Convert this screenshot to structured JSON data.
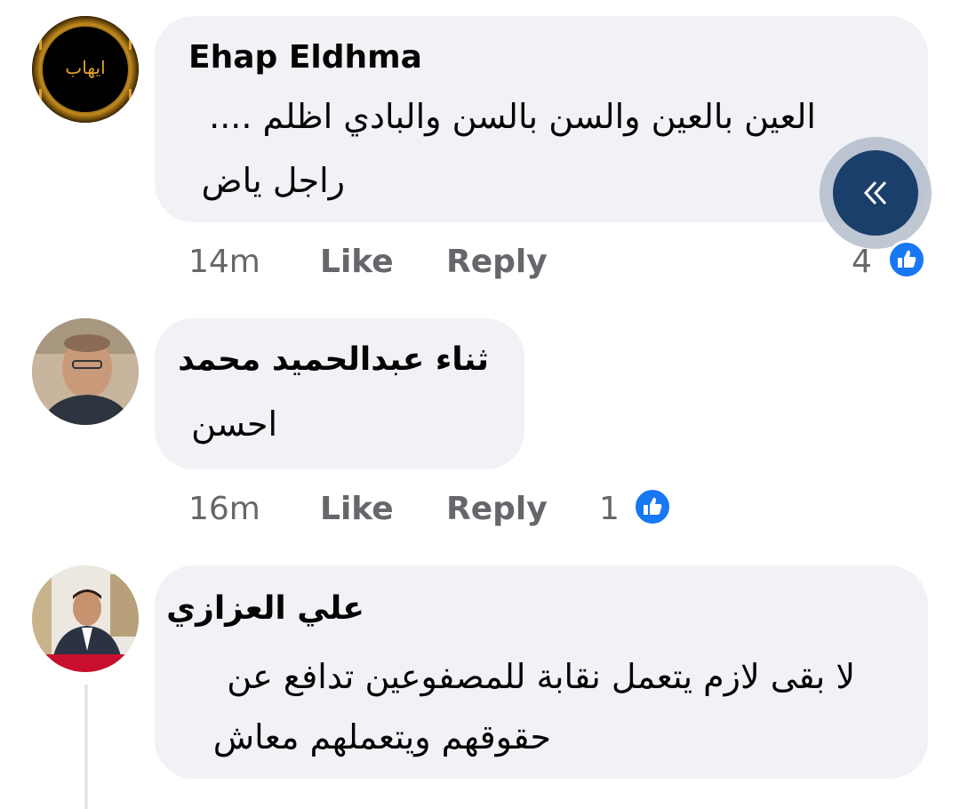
{
  "comments": [
    {
      "avatar_text": "ايهاب",
      "author": "Ehap Eldhma",
      "lines": [
        "العين بالعين والسن بالسن والبادي اظلم ....",
        "راجل ياض"
      ],
      "time": "14m",
      "like_label": "Like",
      "reply_label": "Reply",
      "reaction_count": "4"
    },
    {
      "author": "ثناء عبدالحميد محمد",
      "lines": [
        "احسن"
      ],
      "time": "16m",
      "like_label": "Like",
      "reply_label": "Reply",
      "reaction_count": "1"
    },
    {
      "author": "علي العزازي",
      "lines": [
        "لا بقى لازم يتعمل نقابة للمصفوعين تدافع عن",
        "حقوقهم ويتعملهم معاش"
      ]
    }
  ],
  "icons": {
    "like_badge": "thumbs-up-icon",
    "fab": "double-chevron-left-icon"
  },
  "colors": {
    "bubble": "#f0f2f5",
    "meta_text": "#65676b",
    "like_blue": "#1877f2",
    "fab": "#1b3f6b"
  }
}
